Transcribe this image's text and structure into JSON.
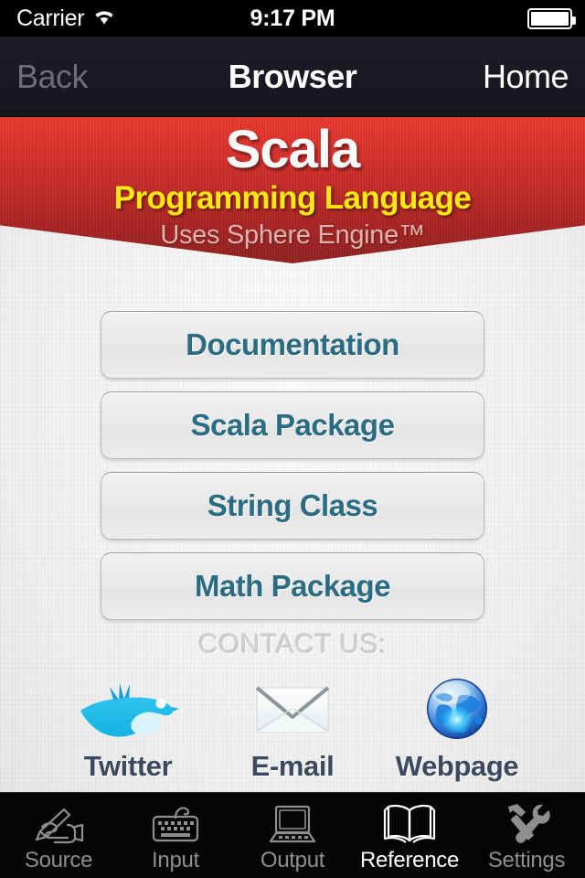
{
  "status_bar": {
    "carrier": "Carrier",
    "wifi_icon": "wifi-icon",
    "time": "9:17 PM",
    "battery_icon": "battery-full-icon"
  },
  "nav_bar": {
    "back_label": "Back",
    "title": "Browser",
    "home_label": "Home"
  },
  "banner": {
    "title": "Scala",
    "subtitle": "Programming Language",
    "engine_note": "Uses Sphere Engine™",
    "colors": {
      "gradient_top": "#e6392e",
      "gradient_bottom": "#8e2020",
      "title_color": "#fafafa",
      "subtitle_color": "#ffe812",
      "engine_note_color": "#dfb3ad"
    }
  },
  "links": {
    "accent_color": "#2b6c85",
    "items": [
      {
        "label": "Documentation"
      },
      {
        "label": "Scala Package"
      },
      {
        "label": "String Class"
      },
      {
        "label": "Math Package"
      }
    ]
  },
  "contact": {
    "heading": "CONTACT US:",
    "items": [
      {
        "label": "Twitter",
        "icon": "twitter-bird-icon"
      },
      {
        "label": "E-mail",
        "icon": "envelope-icon"
      },
      {
        "label": "Webpage",
        "icon": "globe-icon"
      }
    ]
  },
  "tab_bar": {
    "active_index": 3,
    "active_color": "#ffffff",
    "inactive_color": "#8e8e8e",
    "items": [
      {
        "label": "Source",
        "icon": "hand-writing-icon"
      },
      {
        "label": "Input",
        "icon": "keyboard-icon"
      },
      {
        "label": "Output",
        "icon": "computer-icon"
      },
      {
        "label": "Reference",
        "icon": "open-book-icon"
      },
      {
        "label": "Settings",
        "icon": "hammer-wrench-icon"
      }
    ]
  }
}
